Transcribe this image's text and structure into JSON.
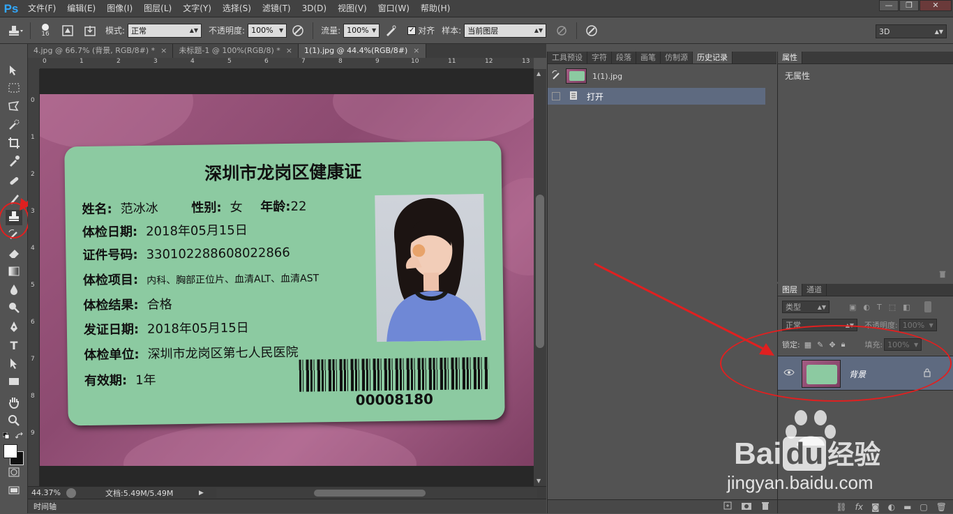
{
  "app": {
    "logo": "Ps"
  },
  "menu": [
    "文件(F)",
    "编辑(E)",
    "图像(I)",
    "图层(L)",
    "文字(Y)",
    "选择(S)",
    "滤镜(T)",
    "3D(D)",
    "视图(V)",
    "窗口(W)",
    "帮助(H)"
  ],
  "window_controls": {
    "minimize": "—",
    "restore": "❐",
    "close": "✕"
  },
  "options": {
    "brush_size": "16",
    "mode_label": "模式:",
    "mode_value": "正常",
    "opacity_label": "不透明度:",
    "opacity_value": "100%",
    "flow_label": "流量:",
    "flow_value": "100%",
    "align_label": "对齐",
    "sample_label": "样本:",
    "sample_value": "当前图层",
    "workspace_value": "3D"
  },
  "doc_tabs": [
    {
      "label": "4.jpg @ 66.7% (背景, RGB/8#) *",
      "close": "×"
    },
    {
      "label": "未标题-1 @ 100%(RGB/8) *",
      "close": "×"
    },
    {
      "label": "1(1).jpg @ 44.4%(RGB/8#)",
      "close": "×"
    }
  ],
  "ruler": {
    "top": [
      "0",
      "1",
      "2",
      "3",
      "4",
      "5",
      "6",
      "7",
      "8",
      "9",
      "10",
      "11",
      "12",
      "13"
    ],
    "left": [
      "0",
      "1",
      "2",
      "3",
      "4",
      "5",
      "6",
      "7",
      "8",
      "9"
    ]
  },
  "card": {
    "title": "深圳市龙岗区健康证",
    "name_label": "姓名:",
    "name_value": "范冰冰",
    "gender_label": "性别:",
    "gender_value": "女",
    "age_label": "年龄:",
    "age_value": "22",
    "exam_date_label": "体检日期:",
    "exam_date_value": "2018年05月15日",
    "id_label": "证件号码:",
    "id_value": "330102288608022866",
    "items_label": "体检项目:",
    "items_value": "内科、胸部正位片、血清ALT、血清AST",
    "result_label": "体检结果:",
    "result_value": "合格",
    "issue_date_label": "发证日期:",
    "issue_date_value": "2018年05月15日",
    "unit_label": "体检单位:",
    "unit_value": "深圳市龙岗区第七人民医院",
    "validity_label": "有效期:",
    "validity_value": "1年",
    "barcode_number": "00008180"
  },
  "status": {
    "zoom": "44.37%",
    "doc_label": "文档:5.49M/5.49M"
  },
  "timeline": {
    "label": "时间轴"
  },
  "history_panel": {
    "tabs": [
      "工具预设",
      "字符",
      "段落",
      "画笔",
      "仿制源",
      "历史记录"
    ],
    "active_tab": "历史记录",
    "snapshot_name": "1(1).jpg",
    "step": "打开"
  },
  "properties_panel": {
    "tab": "属性",
    "content": "无属性"
  },
  "layers_panel": {
    "tabs": [
      "图层",
      "通道"
    ],
    "filter_kind": "类型",
    "blend_mode": "正常",
    "opacity_label": "不透明度:",
    "opacity_value": "100%",
    "lock_label": "锁定:",
    "fill_label": "填充:",
    "fill_value": "100%",
    "layer_name": "背景"
  },
  "watermark": {
    "brand": "Bai",
    "brand2": "du",
    "cn": "经验",
    "url": "jingyan.baidu.com"
  },
  "colors": {
    "annotation_red": "#e02020",
    "card_green": "#8ccaa1",
    "leather_pink": "#a35c83",
    "selection_blue": "#5e6a80"
  }
}
